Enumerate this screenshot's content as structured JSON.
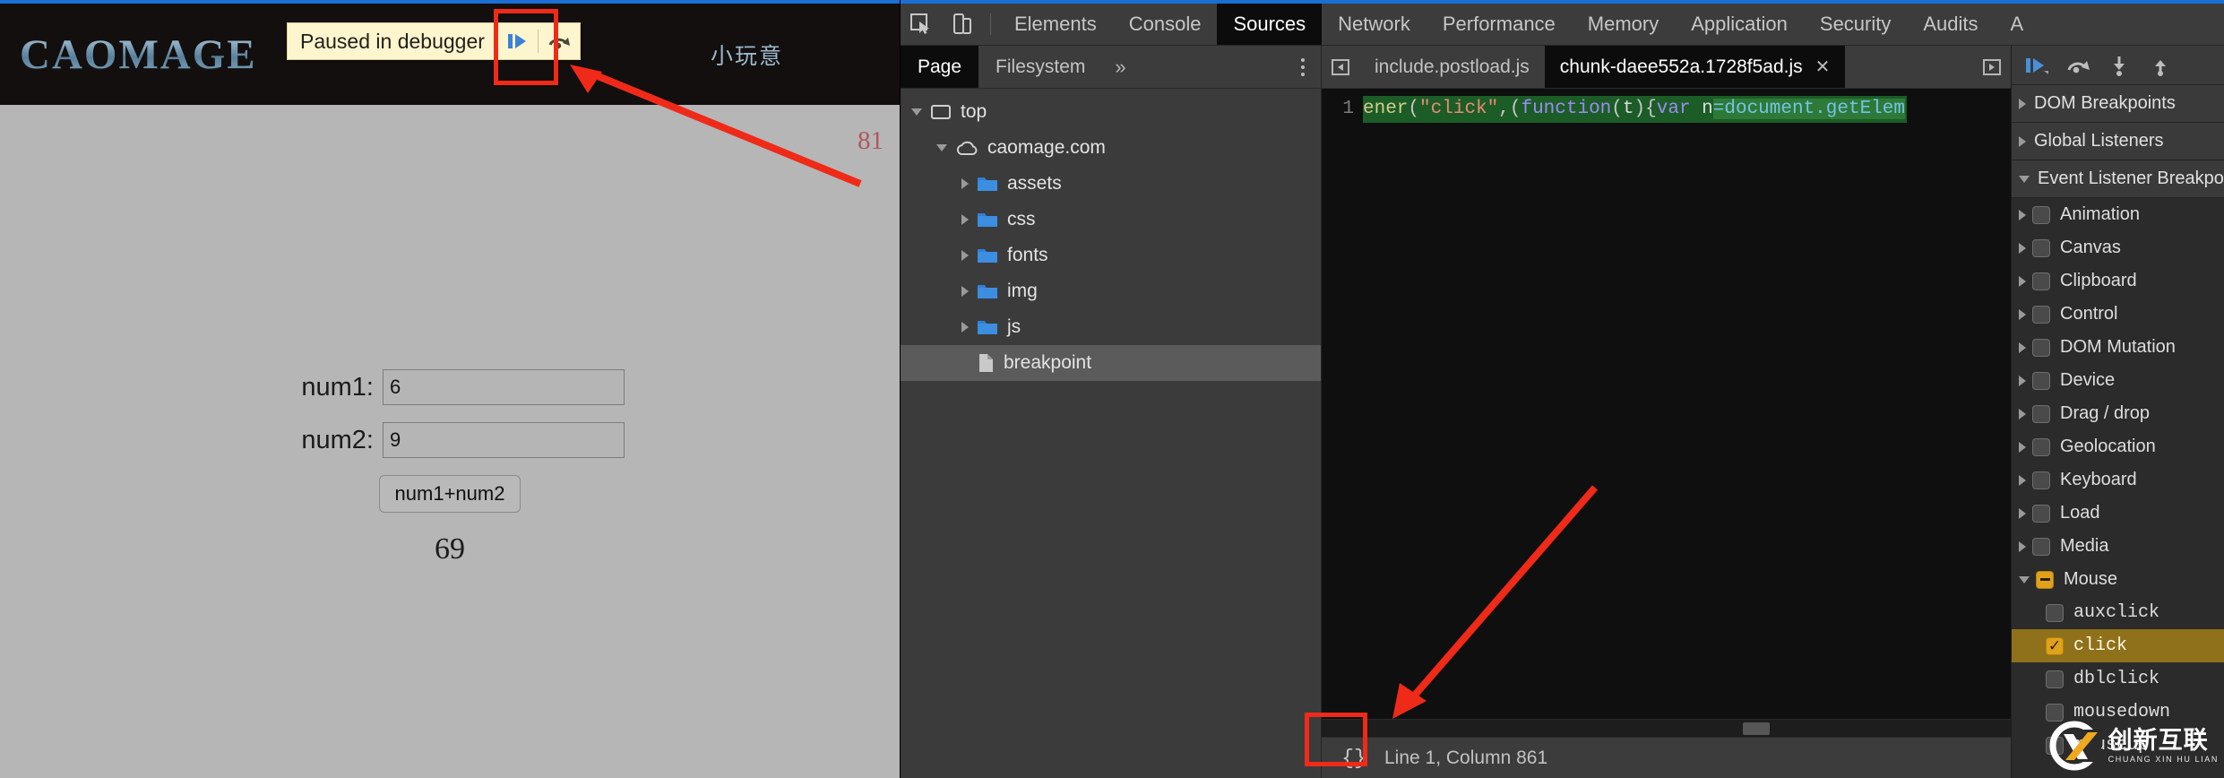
{
  "page": {
    "brand": "CAOMAGE",
    "nav_item": "小玩意",
    "badge": "81",
    "infobar": {
      "text": "Paused in debugger",
      "resume_icon": "resume-script-icon",
      "step_over_icon": "step-over-icon"
    },
    "form": {
      "label1": "num1:",
      "value1": "6",
      "label2": "num2:",
      "value2": "9",
      "button": "num1+num2",
      "result": "69"
    }
  },
  "devtools": {
    "toolbar": {
      "inspect_icon": "inspect-element-icon",
      "device_icon": "device-toolbar-icon",
      "tabs": [
        {
          "label": "Elements",
          "active": false
        },
        {
          "label": "Console",
          "active": false
        },
        {
          "label": "Sources",
          "active": true
        },
        {
          "label": "Network",
          "active": false
        },
        {
          "label": "Performance",
          "active": false
        },
        {
          "label": "Memory",
          "active": false
        },
        {
          "label": "Application",
          "active": false
        },
        {
          "label": "Security",
          "active": false
        },
        {
          "label": "Audits",
          "active": false
        },
        {
          "label": "A",
          "active": false
        }
      ]
    },
    "navigator": {
      "tabs": [
        {
          "label": "Page",
          "active": true
        },
        {
          "label": "Filesystem",
          "active": false
        }
      ],
      "overflow_label": "»",
      "kebab_icon": "more-options-icon",
      "tree": [
        {
          "label": "top",
          "icon": "frame-icon",
          "twisty": "down",
          "indent": 0,
          "selected": false
        },
        {
          "label": "caomage.com",
          "icon": "cloud-icon",
          "twisty": "down",
          "indent": 1,
          "selected": false
        },
        {
          "label": "assets",
          "icon": "folder-icon",
          "twisty": "right",
          "indent": 2,
          "selected": false
        },
        {
          "label": "css",
          "icon": "folder-icon",
          "twisty": "right",
          "indent": 2,
          "selected": false
        },
        {
          "label": "fonts",
          "icon": "folder-icon",
          "twisty": "right",
          "indent": 2,
          "selected": false
        },
        {
          "label": "img",
          "icon": "folder-icon",
          "twisty": "right",
          "indent": 2,
          "selected": false
        },
        {
          "label": "js",
          "icon": "folder-icon",
          "twisty": "right",
          "indent": 2,
          "selected": false
        },
        {
          "label": "breakpoint",
          "icon": "file-icon",
          "twisty": "none",
          "indent": 2,
          "selected": true
        }
      ]
    },
    "editor": {
      "scroll_left_icon": "scroll-tabs-left-icon",
      "scroll_right_icon": "scroll-tabs-right-icon",
      "tabs": [
        {
          "label": "include.postload.js",
          "active": false,
          "close": ""
        },
        {
          "label": "chunk-daee552a.1728f5ad.js",
          "active": true,
          "close": "✕"
        }
      ],
      "line_number": "1",
      "code_tokens": [
        {
          "t": "ener",
          "c": "tok-fn"
        },
        {
          "t": "(",
          "c": "tok-punc"
        },
        {
          "t": "\"click\"",
          "c": "tok-str"
        },
        {
          "t": ",(",
          "c": "tok-punc"
        },
        {
          "t": "function",
          "c": "tok-kw"
        },
        {
          "t": "(",
          "c": "tok-punc"
        },
        {
          "t": "t",
          "c": "tok-plain"
        },
        {
          "t": "){",
          "c": "tok-punc"
        },
        {
          "t": "var",
          "c": "tok-var"
        },
        {
          "t": " n",
          "c": "tok-plain"
        },
        {
          "t": "=document.getElem",
          "c": "tok-id"
        }
      ],
      "status": {
        "pretty_print_label": "{}",
        "position": "Line 1, Column 861"
      }
    },
    "sidebar": {
      "debug_buttons": [
        {
          "icon": "resume-script-icon",
          "name": "resume-button"
        },
        {
          "icon": "step-over-icon",
          "name": "step-over-button"
        },
        {
          "icon": "step-into-icon",
          "name": "step-into-button"
        },
        {
          "icon": "step-out-icon",
          "name": "step-out-button"
        }
      ],
      "sections": [
        {
          "label": "DOM Breakpoints",
          "expanded": false
        },
        {
          "label": "Global Listeners",
          "expanded": false
        },
        {
          "label": "Event Listener Breakpoints",
          "expanded": true
        }
      ],
      "event_categories": [
        {
          "label": "Animation",
          "state": "off"
        },
        {
          "label": "Canvas",
          "state": "off"
        },
        {
          "label": "Clipboard",
          "state": "off"
        },
        {
          "label": "Control",
          "state": "off"
        },
        {
          "label": "DOM Mutation",
          "state": "off"
        },
        {
          "label": "Device",
          "state": "off"
        },
        {
          "label": "Drag / drop",
          "state": "off"
        },
        {
          "label": "Geolocation",
          "state": "off"
        },
        {
          "label": "Keyboard",
          "state": "off"
        },
        {
          "label": "Load",
          "state": "off"
        },
        {
          "label": "Media",
          "state": "off"
        },
        {
          "label": "Mouse",
          "state": "mixed",
          "expanded": true
        }
      ],
      "mouse_events": [
        {
          "label": "auxclick",
          "state": "off"
        },
        {
          "label": "click",
          "state": "on"
        },
        {
          "label": "dblclick",
          "state": "off"
        },
        {
          "label": "mousedown",
          "state": "off"
        },
        {
          "label": "mouseup",
          "state": "off"
        }
      ]
    }
  },
  "watermark": {
    "cn": "创新互联",
    "en": "CHUANG XIN HU LIAN"
  },
  "colors": {
    "accent_blue": "#1a6fd4",
    "annotation_red": "#f02a18",
    "highlight_amber": "#8e711a",
    "exec_green": "#1c5c26"
  }
}
